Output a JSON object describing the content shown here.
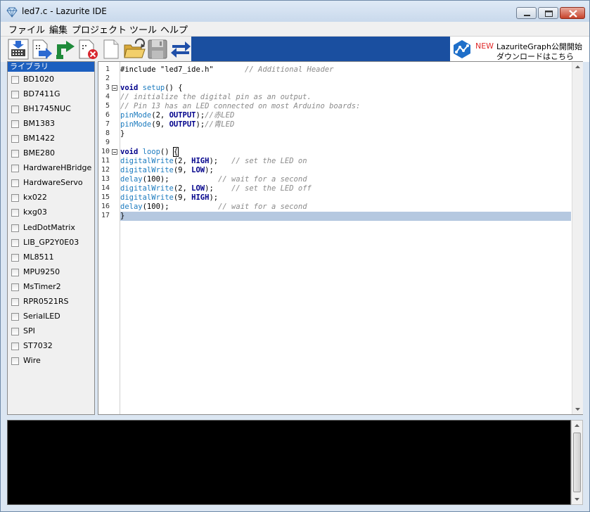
{
  "window": {
    "title": "led7.c - Lazurite IDE",
    "icon": "diamond-icon"
  },
  "menu": [
    "ファイル",
    "編集",
    "プロジェクト",
    "ツール",
    "ヘルプ"
  ],
  "toolbar": {
    "icons": [
      "upload-icon",
      "download-arrow-icon",
      "reload-arrow-icon",
      "close-file-icon",
      "new-file-icon",
      "open-folder-icon",
      "save-icon",
      "swap-arrows-icon"
    ]
  },
  "banner": {
    "new": "NEW",
    "line1": "LazuriteGraph公開開始",
    "line2": "ダウンロードはこちら",
    "accent": "#1a4fa0"
  },
  "library": {
    "header": "ライブラリ",
    "items": [
      "BD1020",
      "BD7411G",
      "BH1745NUC",
      "BM1383",
      "BM1422",
      "BME280",
      "HardwareHBridge",
      "HardwareServo",
      "kx022",
      "kxg03",
      "LedDotMatrix",
      "LIB_GP2Y0E03",
      "ML8511",
      "MPU9250",
      "MsTimer2",
      "RPR0521RS",
      "SerialLED",
      "SPI",
      "ST7032",
      "Wire"
    ]
  },
  "editor": {
    "line_numbers": [
      "1",
      "2",
      "3",
      "4",
      "5",
      "6",
      "7",
      "8",
      "9",
      "10",
      "11",
      "12",
      "13",
      "14",
      "15",
      "16",
      "17"
    ],
    "lines": {
      "l1a": "#include \"led7_ide.h\"",
      "l1b": "// Additional Header",
      "l3a": "void",
      "l3b": "setup",
      "l3c": "() {",
      "l4": "// initialize the digital pin as an output.",
      "l5": "// Pin 13 has an LED connected on most Arduino boards:",
      "l6a": "pinMode",
      "l6b": "(2, ",
      "l6c": "OUTPUT",
      "l6d": ");",
      "l6e": "//赤LED",
      "l7a": "pinMode",
      "l7b": "(9, ",
      "l7c": "OUTPUT",
      "l7d": ");",
      "l7e": "//青LED",
      "l8": "}",
      "l10a": "void",
      "l10b": "loop",
      "l10c": "() ",
      "l10d": "{",
      "l11a": "digitalWrite",
      "l11b": "(2, ",
      "l11c": "HIGH",
      "l11d": ");",
      "l11e": "// set the LED on",
      "l12a": "digitalWrite",
      "l12b": "(9, ",
      "l12c": "LOW",
      "l12d": ");",
      "l13a": "delay",
      "l13b": "(100);",
      "l13c": "// wait for a second",
      "l14a": "digitalWrite",
      "l14b": "(2, ",
      "l14c": "LOW",
      "l14d": ");",
      "l14e": "// set the LED off",
      "l15a": "digitalWrite",
      "l15b": "(9, ",
      "l15c": "HIGH",
      "l15d": ");",
      "l16a": "delay",
      "l16b": "(100);",
      "l16c": "// wait for a second",
      "l17": "}"
    }
  },
  "console": {
    "text": ""
  }
}
